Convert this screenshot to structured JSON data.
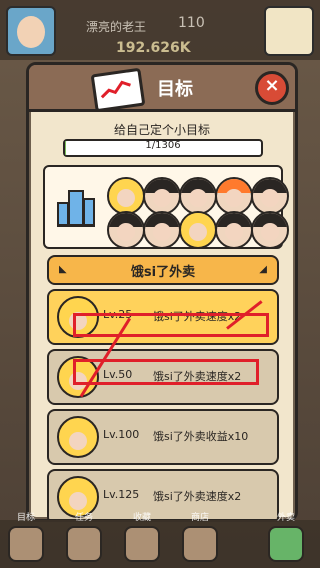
{
  "top": {
    "name": "漂亮的老王",
    "level": "110",
    "money": "192.626K"
  },
  "modal": {
    "title": "目标",
    "close": "×",
    "subtitle": "给自己定个小目标",
    "progress_text": "1/1306",
    "progress_value": 1,
    "progress_total": 1306,
    "category": {
      "title": "饿si了外卖",
      "left_marker": "◣",
      "right_marker": "◢"
    },
    "items": [
      {
        "level": "Lv.25",
        "desc": "饿si了外卖速度x2",
        "selected": true
      },
      {
        "level": "Lv.50",
        "desc": "饿si了外卖速度x2",
        "selected": false
      },
      {
        "level": "Lv.100",
        "desc": "饿si了外卖收益x10",
        "selected": false
      },
      {
        "level": "Lv.125",
        "desc": "饿si了外卖速度x2",
        "selected": false
      }
    ]
  },
  "bottom_nav": {
    "items": [
      {
        "label": "目标",
        "icon": "target-icon"
      },
      {
        "label": "任务",
        "icon": "task-icon"
      },
      {
        "label": "收藏",
        "icon": "collection-icon"
      },
      {
        "label": "商店",
        "icon": "shop-icon"
      },
      {
        "label": "外卖",
        "icon": "delivery-icon"
      }
    ]
  }
}
